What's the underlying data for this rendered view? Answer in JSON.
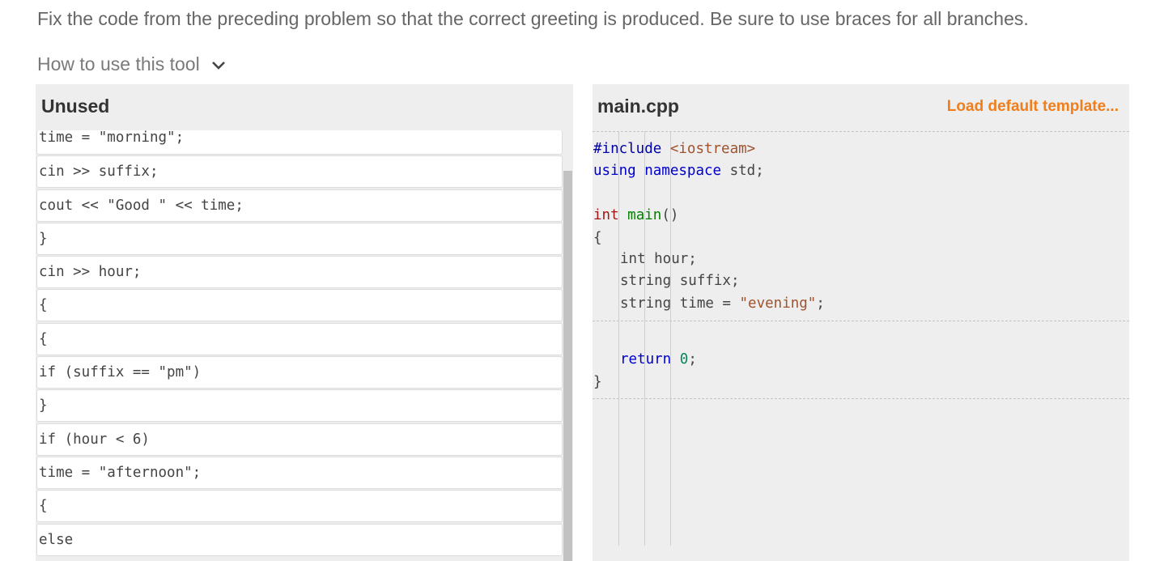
{
  "instructions": "Fix the code from the preceding problem so that the correct greeting is produced. Be sure to use braces for all branches.",
  "howto_label": "How to use this tool",
  "unused": {
    "title": "Unused",
    "blocks": [
      {
        "text": "time = \"morning\";"
      },
      {
        "text": "cin >> suffix;"
      },
      {
        "text": "cout << \"Good \" << time;"
      },
      {
        "text": "}"
      },
      {
        "text": "cin >> hour;"
      },
      {
        "text": "{"
      },
      {
        "text": "{"
      },
      {
        "text": "if (suffix == \"pm\")"
      },
      {
        "text": "}"
      },
      {
        "text": "if (hour < 6)"
      },
      {
        "text": "time = \"afternoon\";"
      },
      {
        "text": "{"
      },
      {
        "text": "else"
      }
    ]
  },
  "main": {
    "title": "main.cpp",
    "load_link": "Load default template...",
    "code": {
      "include": "#include",
      "header": "<iostream>",
      "using": "using",
      "namespace": "namespace",
      "std": " std;",
      "int": "int",
      "main": "main",
      "parens": "()",
      "open_brace": "{",
      "decl_hour": "int hour;",
      "decl_suffix": "string suffix;",
      "decl_time_a": "string time = ",
      "decl_time_str": "\"evening\"",
      "semi": ";",
      "return_kw": "return",
      "zero": "0",
      "close_brace": "}"
    }
  },
  "colors": {
    "accent": "#f07e1b",
    "panel_bg": "#eeeeee"
  }
}
